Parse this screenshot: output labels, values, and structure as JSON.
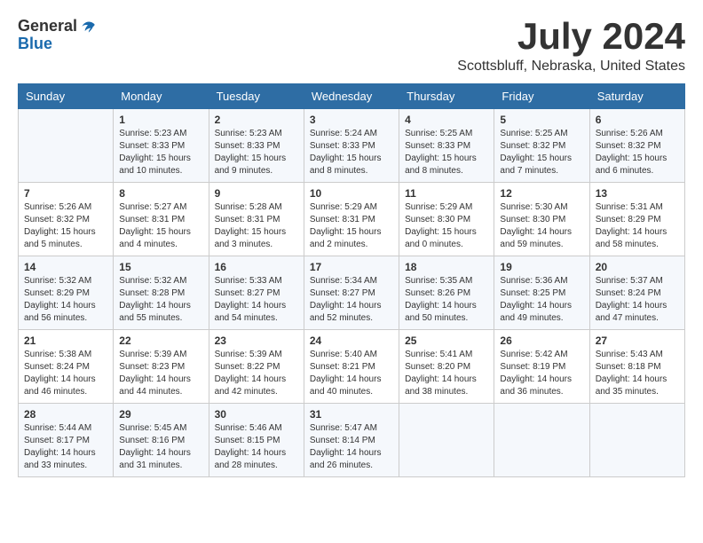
{
  "logo": {
    "general": "General",
    "blue": "Blue"
  },
  "title": "July 2024",
  "location": "Scottsbluff, Nebraska, United States",
  "days_of_week": [
    "Sunday",
    "Monday",
    "Tuesday",
    "Wednesday",
    "Thursday",
    "Friday",
    "Saturday"
  ],
  "weeks": [
    [
      {
        "day": "",
        "content": ""
      },
      {
        "day": "1",
        "content": "Sunrise: 5:23 AM\nSunset: 8:33 PM\nDaylight: 15 hours\nand 10 minutes."
      },
      {
        "day": "2",
        "content": "Sunrise: 5:23 AM\nSunset: 8:33 PM\nDaylight: 15 hours\nand 9 minutes."
      },
      {
        "day": "3",
        "content": "Sunrise: 5:24 AM\nSunset: 8:33 PM\nDaylight: 15 hours\nand 8 minutes."
      },
      {
        "day": "4",
        "content": "Sunrise: 5:25 AM\nSunset: 8:33 PM\nDaylight: 15 hours\nand 8 minutes."
      },
      {
        "day": "5",
        "content": "Sunrise: 5:25 AM\nSunset: 8:32 PM\nDaylight: 15 hours\nand 7 minutes."
      },
      {
        "day": "6",
        "content": "Sunrise: 5:26 AM\nSunset: 8:32 PM\nDaylight: 15 hours\nand 6 minutes."
      }
    ],
    [
      {
        "day": "7",
        "content": "Sunrise: 5:26 AM\nSunset: 8:32 PM\nDaylight: 15 hours\nand 5 minutes."
      },
      {
        "day": "8",
        "content": "Sunrise: 5:27 AM\nSunset: 8:31 PM\nDaylight: 15 hours\nand 4 minutes."
      },
      {
        "day": "9",
        "content": "Sunrise: 5:28 AM\nSunset: 8:31 PM\nDaylight: 15 hours\nand 3 minutes."
      },
      {
        "day": "10",
        "content": "Sunrise: 5:29 AM\nSunset: 8:31 PM\nDaylight: 15 hours\nand 2 minutes."
      },
      {
        "day": "11",
        "content": "Sunrise: 5:29 AM\nSunset: 8:30 PM\nDaylight: 15 hours\nand 0 minutes."
      },
      {
        "day": "12",
        "content": "Sunrise: 5:30 AM\nSunset: 8:30 PM\nDaylight: 14 hours\nand 59 minutes."
      },
      {
        "day": "13",
        "content": "Sunrise: 5:31 AM\nSunset: 8:29 PM\nDaylight: 14 hours\nand 58 minutes."
      }
    ],
    [
      {
        "day": "14",
        "content": "Sunrise: 5:32 AM\nSunset: 8:29 PM\nDaylight: 14 hours\nand 56 minutes."
      },
      {
        "day": "15",
        "content": "Sunrise: 5:32 AM\nSunset: 8:28 PM\nDaylight: 14 hours\nand 55 minutes."
      },
      {
        "day": "16",
        "content": "Sunrise: 5:33 AM\nSunset: 8:27 PM\nDaylight: 14 hours\nand 54 minutes."
      },
      {
        "day": "17",
        "content": "Sunrise: 5:34 AM\nSunset: 8:27 PM\nDaylight: 14 hours\nand 52 minutes."
      },
      {
        "day": "18",
        "content": "Sunrise: 5:35 AM\nSunset: 8:26 PM\nDaylight: 14 hours\nand 50 minutes."
      },
      {
        "day": "19",
        "content": "Sunrise: 5:36 AM\nSunset: 8:25 PM\nDaylight: 14 hours\nand 49 minutes."
      },
      {
        "day": "20",
        "content": "Sunrise: 5:37 AM\nSunset: 8:24 PM\nDaylight: 14 hours\nand 47 minutes."
      }
    ],
    [
      {
        "day": "21",
        "content": "Sunrise: 5:38 AM\nSunset: 8:24 PM\nDaylight: 14 hours\nand 46 minutes."
      },
      {
        "day": "22",
        "content": "Sunrise: 5:39 AM\nSunset: 8:23 PM\nDaylight: 14 hours\nand 44 minutes."
      },
      {
        "day": "23",
        "content": "Sunrise: 5:39 AM\nSunset: 8:22 PM\nDaylight: 14 hours\nand 42 minutes."
      },
      {
        "day": "24",
        "content": "Sunrise: 5:40 AM\nSunset: 8:21 PM\nDaylight: 14 hours\nand 40 minutes."
      },
      {
        "day": "25",
        "content": "Sunrise: 5:41 AM\nSunset: 8:20 PM\nDaylight: 14 hours\nand 38 minutes."
      },
      {
        "day": "26",
        "content": "Sunrise: 5:42 AM\nSunset: 8:19 PM\nDaylight: 14 hours\nand 36 minutes."
      },
      {
        "day": "27",
        "content": "Sunrise: 5:43 AM\nSunset: 8:18 PM\nDaylight: 14 hours\nand 35 minutes."
      }
    ],
    [
      {
        "day": "28",
        "content": "Sunrise: 5:44 AM\nSunset: 8:17 PM\nDaylight: 14 hours\nand 33 minutes."
      },
      {
        "day": "29",
        "content": "Sunrise: 5:45 AM\nSunset: 8:16 PM\nDaylight: 14 hours\nand 31 minutes."
      },
      {
        "day": "30",
        "content": "Sunrise: 5:46 AM\nSunset: 8:15 PM\nDaylight: 14 hours\nand 28 minutes."
      },
      {
        "day": "31",
        "content": "Sunrise: 5:47 AM\nSunset: 8:14 PM\nDaylight: 14 hours\nand 26 minutes."
      },
      {
        "day": "",
        "content": ""
      },
      {
        "day": "",
        "content": ""
      },
      {
        "day": "",
        "content": ""
      }
    ]
  ]
}
